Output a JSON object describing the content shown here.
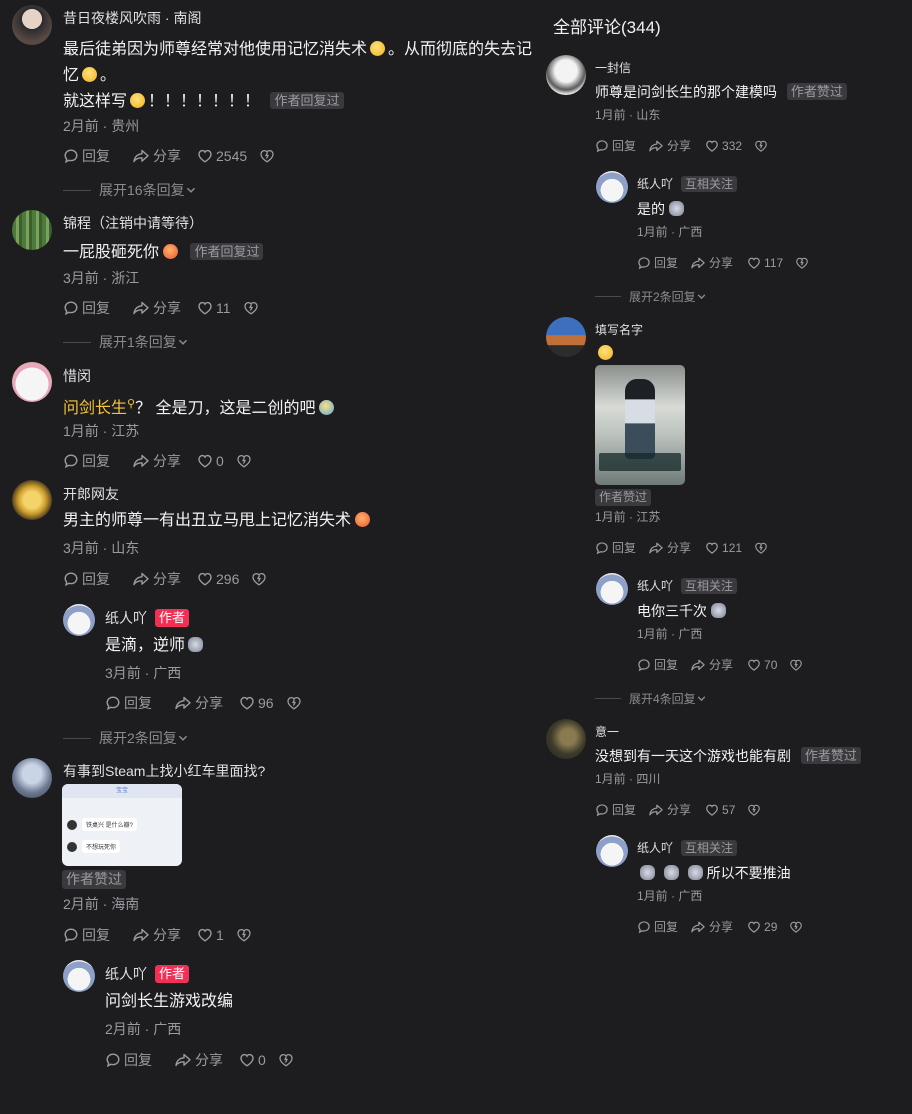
{
  "right_header": "全部评论(344)",
  "left": {
    "c1": {
      "name": "昔日夜楼风吹雨 · 南阁",
      "line1": "最后徒弟因为师尊经常对他使用记忆消失术",
      "line1b": "。从而彻底的失",
      "line2": "去记忆",
      "line2b": "。",
      "line3": "就这样写",
      "line3b": "！！！！！！！",
      "badge": "作者回复过",
      "meta": "2月前 · 贵州",
      "reply": "回复",
      "share": "分享",
      "likes": "2545",
      "expand": "展开16条回复"
    },
    "c2": {
      "name": "锦程（注销中请等待）",
      "text": "一屁股砸死你",
      "badge": "作者回复过",
      "meta": "3月前 · 浙江",
      "reply": "回复",
      "share": "分享",
      "likes": "11",
      "expand": "展开1条回复"
    },
    "c3": {
      "name": "惜闵",
      "link": "问剑长生",
      "text": "？ 全是刀，这是二创的吧",
      "meta": "1月前 · 江苏",
      "reply": "回复",
      "share": "分享",
      "likes": "0"
    },
    "c4": {
      "name": "开郎网友",
      "text": "男主的师尊一有出丑立马甩上记忆消失术",
      "meta": "3月前 · 山东",
      "reply": "回复",
      "share": "分享",
      "likes": "296"
    },
    "c4r": {
      "name": "纸人吖",
      "tag": "作者",
      "text": "是滴，逆师",
      "meta": "3月前 · 广西",
      "reply": "回复",
      "share": "分享",
      "likes": "96",
      "expand": "展开2条回复"
    },
    "c5": {
      "name": "有事到Steam上找小红车里面找?",
      "badge": "作者赞过",
      "meta": "2月前 · 海南",
      "reply": "回复",
      "share": "分享",
      "likes": "1",
      "img": {
        "title": "宝宝",
        "msg1": "铁桌兴 是什么瓣?",
        "msg2": "不想玩死你"
      }
    },
    "c5r": {
      "name": "纸人吖",
      "tag": "作者",
      "text": "问剑长生游戏改编",
      "meta": "2月前 · 广西",
      "reply": "回复",
      "share": "分享",
      "likes": "0"
    }
  },
  "right": {
    "r1": {
      "name": "一封信",
      "text": "师尊是问剑长生的那个建模吗",
      "badge": "作者赞过",
      "meta": "1月前 · 山东",
      "reply": "回复",
      "share": "分享",
      "likes": "332"
    },
    "r1r": {
      "name": "纸人吖",
      "tag": "互相关注",
      "text": "是的",
      "meta": "1月前 · 广西",
      "reply": "回复",
      "share": "分享",
      "likes": "117",
      "expand": "展开2条回复"
    },
    "r2": {
      "name": "填写名字",
      "badge": "作者赞过",
      "meta": "1月前 · 江苏",
      "reply": "回复",
      "share": "分享",
      "likes": "121"
    },
    "r2r": {
      "name": "纸人吖",
      "tag": "互相关注",
      "text": "电你三千次",
      "meta": "1月前 · 广西",
      "reply": "回复",
      "share": "分享",
      "likes": "70",
      "expand": "展开4条回复"
    },
    "r3": {
      "name": "意一",
      "text": "没想到有一天这个游戏也能有剧",
      "badge": "作者赞过",
      "meta": "1月前 · 四川",
      "reply": "回复",
      "share": "分享",
      "likes": "57"
    },
    "r3r": {
      "name": "纸人吖",
      "tag": "互相关注",
      "text": "所以不要推油",
      "meta": "1月前 · 广西",
      "reply": "回复",
      "share": "分享",
      "likes": "29"
    }
  },
  "colors": {
    "bg": "#1d1d20",
    "accent_red": "#f23055",
    "link_yellow": "#f5c33b",
    "meta": "#9a9aa0"
  }
}
